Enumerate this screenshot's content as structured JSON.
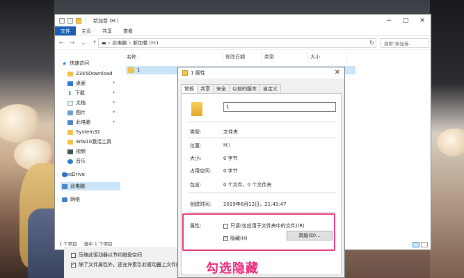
{
  "explorer": {
    "title": "新加卷 (H:)",
    "ribbon_tabs": [
      "文件",
      "主页",
      "共享",
      "查看"
    ],
    "address_parts": [
      "此电脑",
      "新加卷 (H:)"
    ],
    "search_placeholder": "搜索\"新加卷...",
    "columns": [
      "名称",
      "修改日期",
      "类型",
      "大小"
    ],
    "file_name": "1",
    "status_items": "1 个项目",
    "status_selected": "选中 1 个项目",
    "nav_items": [
      {
        "label": "快速访问",
        "icon": "star-icon"
      },
      {
        "label": "2345Download",
        "icon": "folder-icon"
      },
      {
        "label": "桌面",
        "icon": "desktop-icon"
      },
      {
        "label": "下载",
        "icon": "download-icon"
      },
      {
        "label": "文档",
        "icon": "document-icon"
      },
      {
        "label": "图片",
        "icon": "picture-icon"
      },
      {
        "label": "此电脑",
        "icon": "computer-icon"
      },
      {
        "label": "System32",
        "icon": "folder-icon"
      },
      {
        "label": "WIN10激活工具",
        "icon": "folder-icon"
      },
      {
        "label": "视频",
        "icon": "video-icon"
      },
      {
        "label": "音乐",
        "icon": "music-icon"
      },
      {
        "label": "OneDrive",
        "icon": "cloud-icon"
      },
      {
        "label": "此电脑",
        "icon": "computer-icon"
      },
      {
        "label": "网络",
        "icon": "network-icon"
      }
    ],
    "under_options": [
      "压缩此驱动器以节约磁盘空间",
      "除了文件属性外，还允许索引此驱动器上文件的"
    ]
  },
  "dialog": {
    "title": "1 属性",
    "tabs": [
      "常规",
      "共享",
      "安全",
      "以前的版本",
      "自定义"
    ],
    "folder_name": "1",
    "rows": {
      "type_label": "类型:",
      "type_value": "文件夹",
      "location_label": "位置:",
      "location_value": "H:\\",
      "size_label": "大小:",
      "size_value": "0 字节",
      "disk_label": "占用空间:",
      "disk_value": "0 字节",
      "contains_label": "包含:",
      "contains_value": "0 个文件，0 个文件夹",
      "created_label": "创建时间:",
      "created_value": "2019年6月12日，21:43:47",
      "attr_label": "属性:"
    },
    "readonly_label": "只读(仅应用于文件夹中的文件)(R)",
    "hidden_label": "隐藏(H)",
    "advanced_label": "高级(D)..."
  },
  "annotation": "勾选隐藏",
  "colors": {
    "highlight": "#e23b7a",
    "annotation": "#e8287a",
    "ribbon_file": "#1a5fb4"
  }
}
